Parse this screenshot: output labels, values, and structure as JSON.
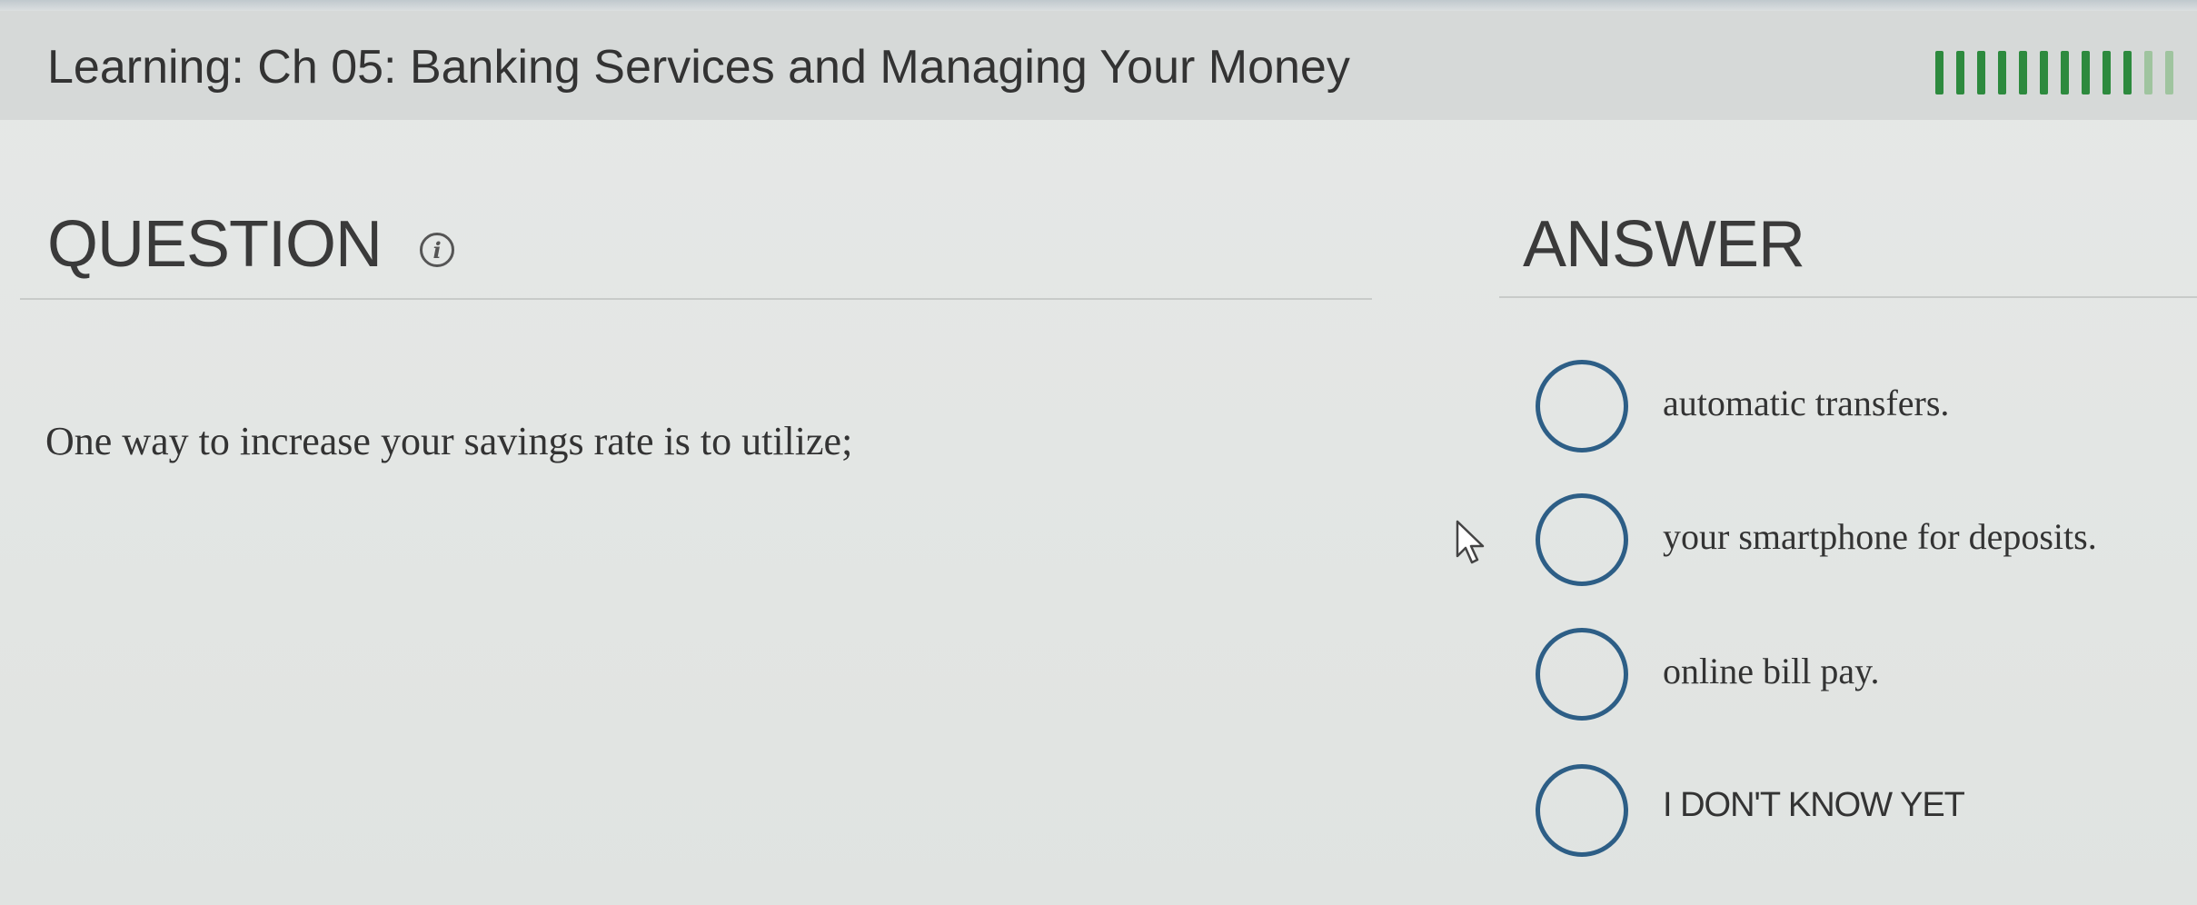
{
  "header": {
    "title": "Learning: Ch 05: Banking Services and Managing Your Money",
    "progress": {
      "filled_segments": 10,
      "total_segments": 12
    }
  },
  "question": {
    "heading": "QUESTION",
    "info_icon": "info-icon",
    "text": "One way to increase your savings rate is to utilize;"
  },
  "answer": {
    "heading": "ANSWER",
    "options": [
      {
        "label": "automatic transfers."
      },
      {
        "label": "your smartphone for deposits."
      },
      {
        "label": "online bill pay."
      },
      {
        "label": "I DON'T KNOW YET"
      }
    ]
  },
  "colors": {
    "progress_fill": "#2d8a3e",
    "progress_empty": "#9fc49f",
    "radio_border": "#2d5e86"
  }
}
